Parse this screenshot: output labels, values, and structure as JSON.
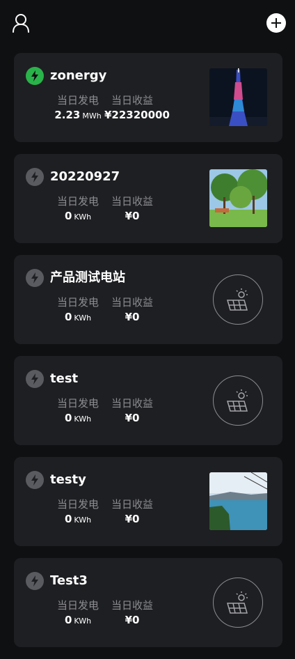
{
  "header": {
    "user_icon": "user-icon",
    "add_icon": "plus-circle-icon"
  },
  "stations": [
    {
      "name": "zonergy",
      "status": "online",
      "label_generation": "当日发电",
      "generation_value": "2.23",
      "generation_unit": "MWh",
      "label_income": "当日收益",
      "income_value": "¥22320000",
      "image": "tower-photo"
    },
    {
      "name": "20220927",
      "status": "offline",
      "label_generation": "当日发电",
      "generation_value": "0",
      "generation_unit": "KWh",
      "label_income": "当日收益",
      "income_value": "¥0",
      "image": "park-photo"
    },
    {
      "name": "产品测试电站",
      "status": "offline",
      "label_generation": "当日发电",
      "generation_value": "0",
      "generation_unit": "KWh",
      "label_income": "当日收益",
      "income_value": "¥0",
      "image": "solar-panel-icon"
    },
    {
      "name": "test",
      "status": "offline",
      "label_generation": "当日发电",
      "generation_value": "0",
      "generation_unit": "KWh",
      "label_income": "当日收益",
      "income_value": "¥0",
      "image": "solar-panel-icon"
    },
    {
      "name": "testy",
      "status": "offline",
      "label_generation": "当日发电",
      "generation_value": "0",
      "generation_unit": "KWh",
      "label_income": "当日收益",
      "income_value": "¥0",
      "image": "lake-photo"
    },
    {
      "name": "Test3",
      "status": "offline",
      "label_generation": "当日发电",
      "generation_value": "0",
      "generation_unit": "KWh",
      "label_income": "当日收益",
      "income_value": "¥0",
      "image": "solar-panel-icon"
    }
  ],
  "colors": {
    "background": "#0f1012",
    "card": "#1e1f22",
    "online": "#29b34a",
    "offline": "#5a5b60",
    "muted_text": "#8c8d91"
  }
}
